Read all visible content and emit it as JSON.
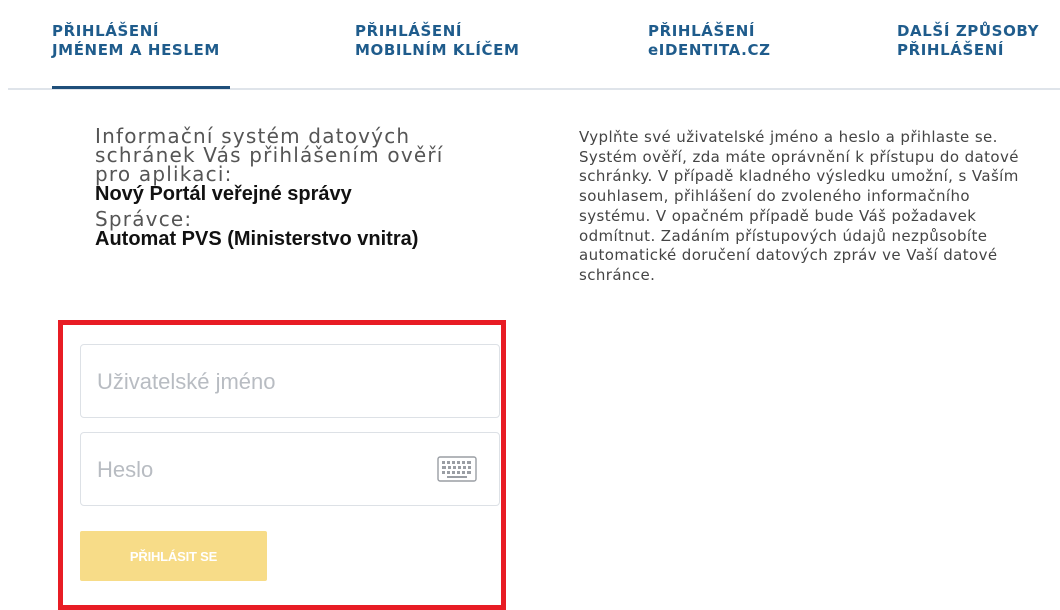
{
  "tabs": [
    {
      "line1": "PŘIHLÁŠENÍ",
      "line2": "JMÉNEM A HESLEM"
    },
    {
      "line1": "PŘIHLÁŠENÍ",
      "line2": "MOBILNÍM KLÍČEM"
    },
    {
      "line1": "PŘIHLÁŠENÍ",
      "line2": "eIDENTITA.CZ"
    },
    {
      "line1": "DALŠÍ ZPŮSOBY",
      "line2": "PŘIHLÁŠENÍ"
    }
  ],
  "active_tab": 0,
  "info": {
    "line1": "Informační systém datových",
    "line2": "schránek Vás přihlášením ověří",
    "line3": "pro aplikaci:",
    "app_name": "Nový Portál veřejné správy",
    "admin_label": "Správce:",
    "admin_name": "Automat PVS (Ministerstvo vnitra)"
  },
  "description": "Vyplňte své uživatelské jméno a heslo a přihlaste se. Systém ověří, zda máte oprávnění k přístupu do datové schránky. V případě kladného výsledku umožní, s Vaším souhlasem, přihlášení do zvoleného informačního systému. V opačném případě bude Váš požadavek odmítnut. Zadáním přístupových údajů nezpůsobíte automatické doručení datových zpráv ve Vaší datové schránce.",
  "form": {
    "username": {
      "placeholder": "Uživatelské jméno",
      "value": ""
    },
    "password": {
      "placeholder": "Heslo",
      "value": ""
    },
    "keyboard_icon": "keyboard-icon",
    "submit_label": "PŘIHLÁSIT SE"
  },
  "colors": {
    "tab_text": "#1f5c8c",
    "active_bar": "#1f4f7a",
    "highlight": "#e81c24",
    "button_bg": "#f7dc88"
  }
}
